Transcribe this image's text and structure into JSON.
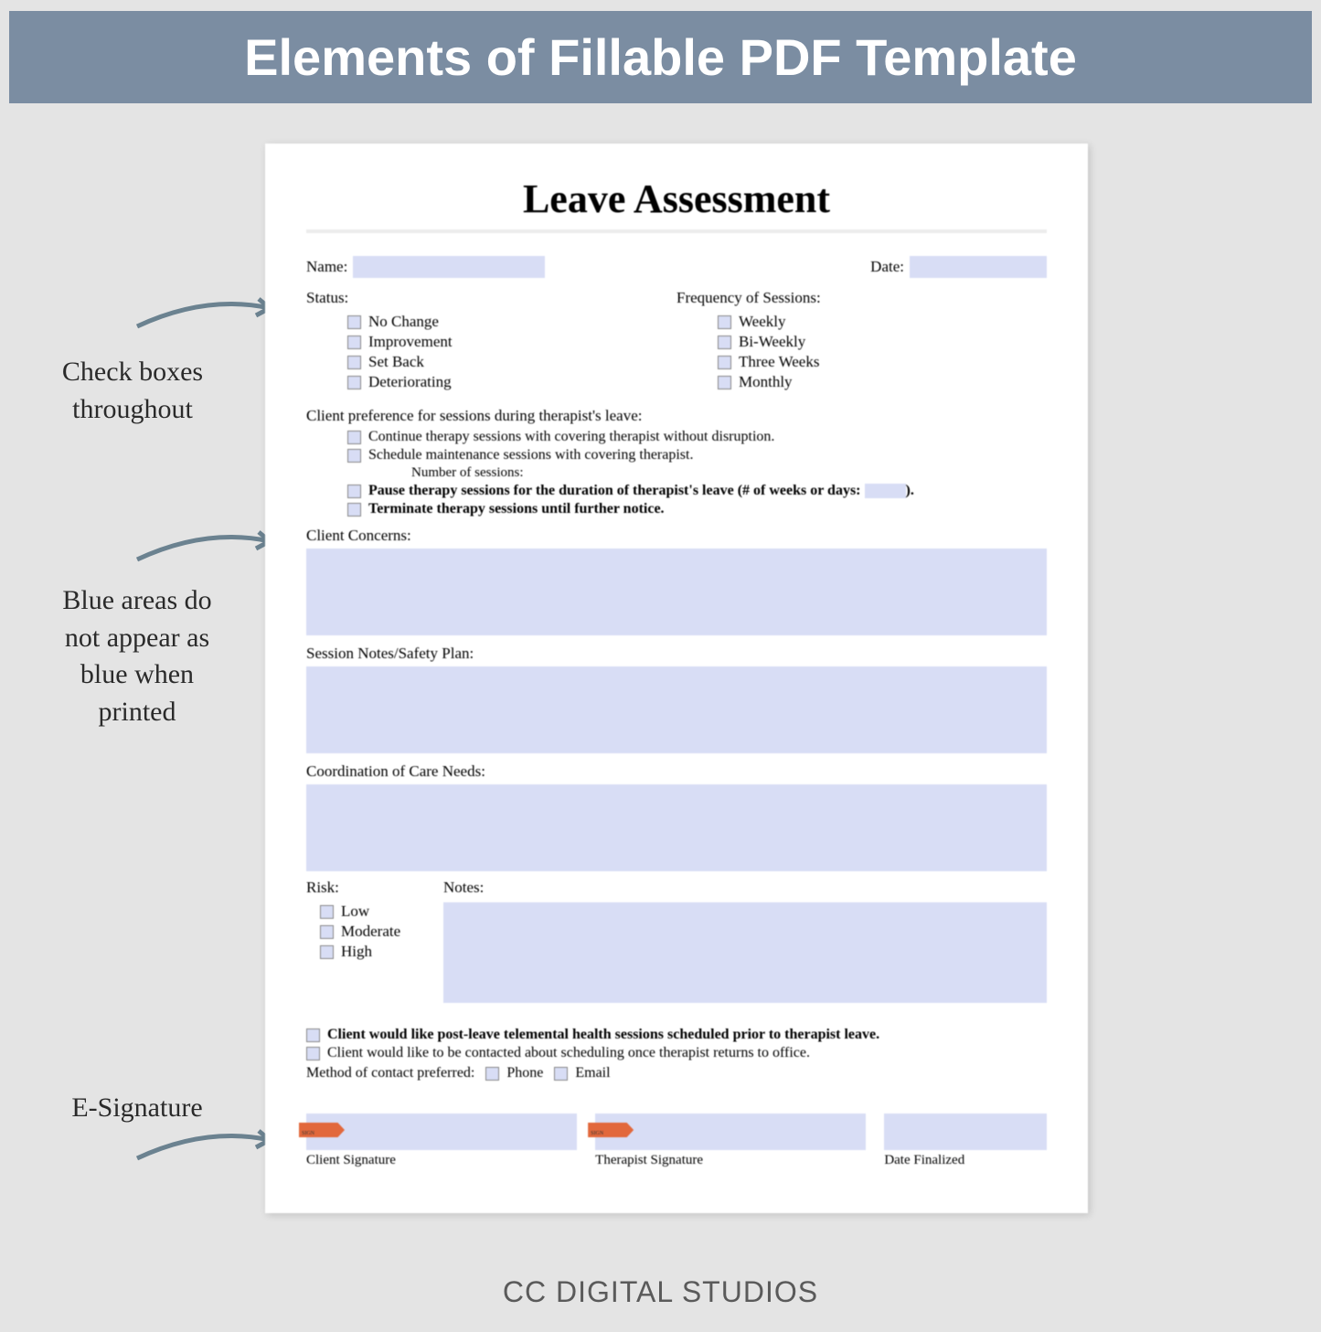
{
  "banner": "Elements of Fillable PDF Template",
  "footer": "CC DIGITAL STUDIOS",
  "annotations": {
    "checkboxes": "Check boxes\nthroughout",
    "blueareas": "Blue areas do\nnot appear as\nblue when\nprinted",
    "esig": "E-Signature"
  },
  "form": {
    "title": "Leave Assessment",
    "name_label": "Name:",
    "date_label": "Date:",
    "status_label": "Status:",
    "freq_label": "Frequency of Sessions:",
    "status_opts": [
      "No Change",
      "Improvement",
      "Set Back",
      "Deteriorating"
    ],
    "freq_opts": [
      "Weekly",
      "Bi-Weekly",
      "Three Weeks",
      "Monthly"
    ],
    "pref_label": "Client preference for sessions during therapist's leave:",
    "pref_opts": [
      "Continue therapy sessions with covering therapist without disruption.",
      "Schedule maintenance sessions with covering therapist."
    ],
    "pref_sub": "Number of sessions:",
    "pref_opts2_a": "Pause therapy sessions for the duration of therapist's leave (# of weeks or days: ",
    "pref_opts2_a_end": ").",
    "pref_opts2_b": "Terminate therapy sessions until further notice.",
    "concerns": "Client Concerns:",
    "session_notes": "Session Notes/Safety Plan:",
    "coord": "Coordination of Care Needs:",
    "risk": "Risk:",
    "notes": "Notes:",
    "risk_opts": [
      "Low",
      "Moderate",
      "High"
    ],
    "bottom1": "Client would like post-leave telemental health sessions scheduled prior to therapist leave.",
    "bottom2": "Client would like to be contacted about scheduling once therapist returns to office.",
    "contact": "Method of contact preferred:",
    "phone": "Phone",
    "email": "Email",
    "sign_tag": "SIGN",
    "sig1": "Client Signature",
    "sig2": "Therapist Signature",
    "sig3": "Date Finalized"
  }
}
